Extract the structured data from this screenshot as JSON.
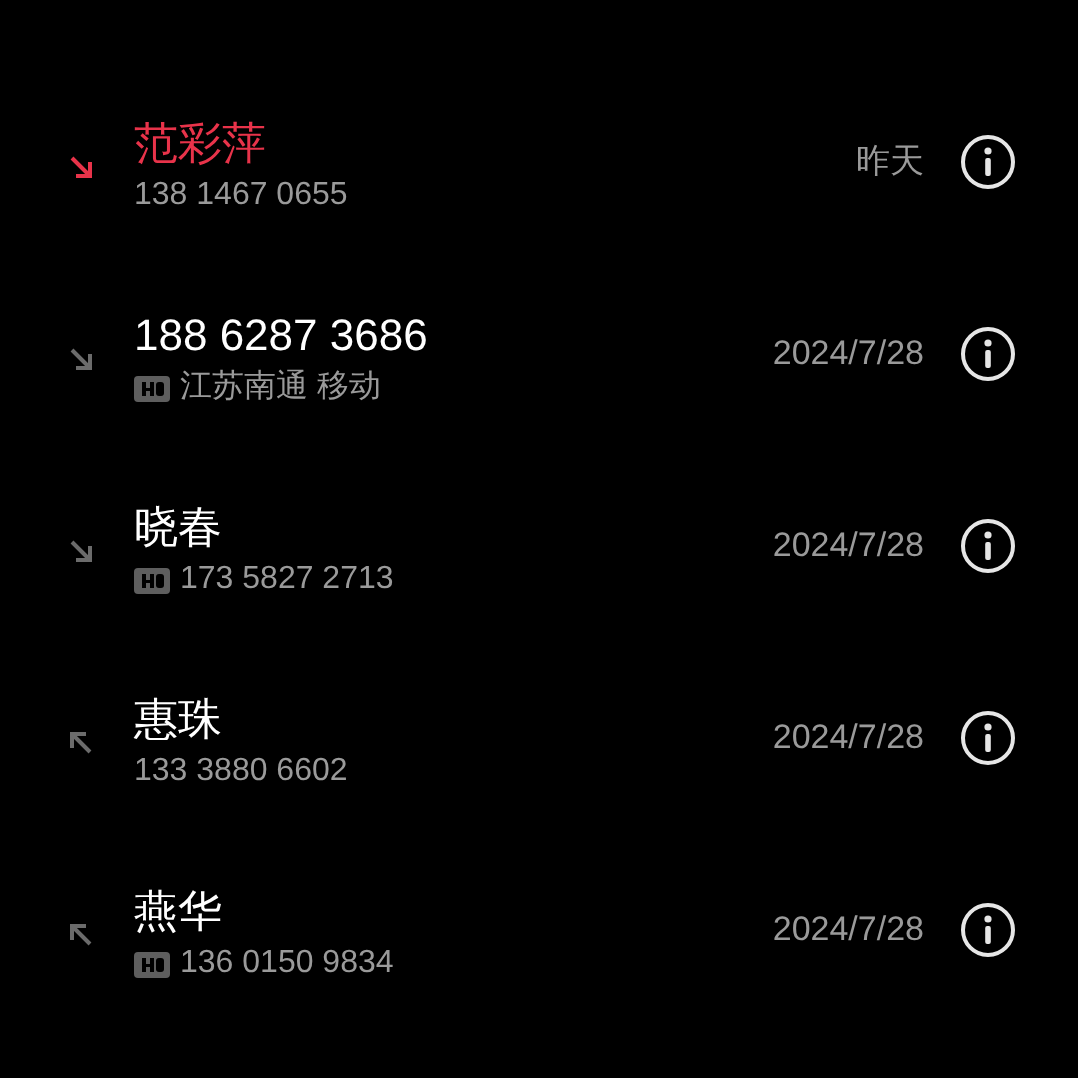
{
  "calls": [
    {
      "kind": "missed",
      "name": "范彩萍",
      "secondary": "138 1467 0655",
      "hd": false,
      "date": "昨天"
    },
    {
      "kind": "incoming",
      "name": "188 6287 3686",
      "secondary": "江苏南通 移动",
      "hd": true,
      "date": "2024/7/28"
    },
    {
      "kind": "incoming",
      "name": "晓春",
      "secondary": "173 5827 2713",
      "hd": true,
      "date": "2024/7/28"
    },
    {
      "kind": "outgoing",
      "name": "惠珠",
      "secondary": "133 3880 6602",
      "hd": false,
      "date": "2024/7/28"
    },
    {
      "kind": "outgoing",
      "name": "燕华",
      "secondary": "136 0150 9834",
      "hd": true,
      "date": "2024/7/28"
    }
  ]
}
